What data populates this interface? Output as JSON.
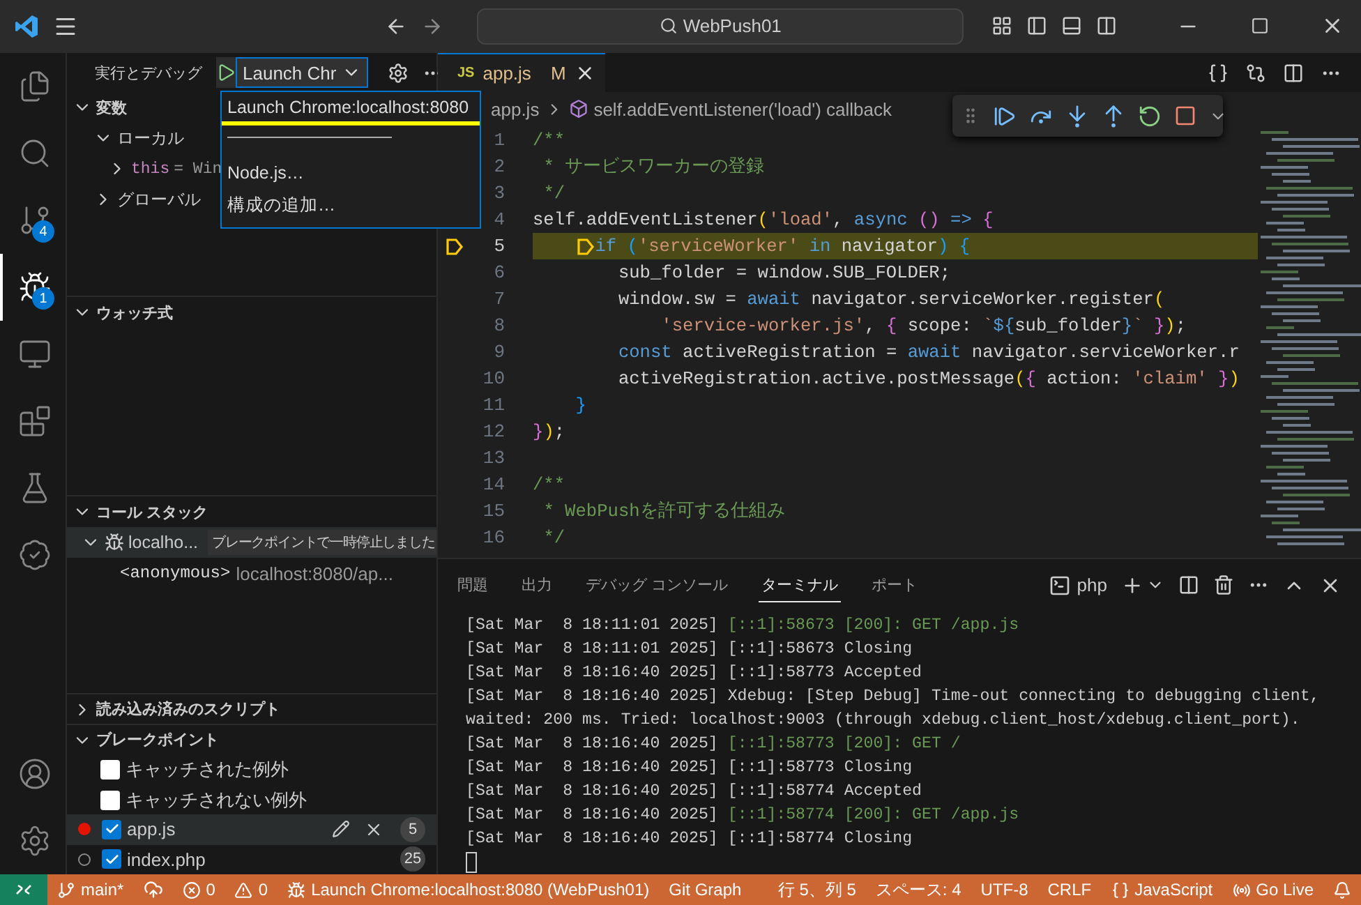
{
  "title_bar": {
    "search": "WebPush01"
  },
  "activity_bar": {
    "items": [
      {
        "kind": "explorer",
        "selected": false
      },
      {
        "kind": "search",
        "selected": false
      },
      {
        "kind": "source-control",
        "badge": "4",
        "selected": false
      },
      {
        "kind": "debug",
        "badge": "1",
        "selected": true
      },
      {
        "kind": "remote",
        "selected": false
      },
      {
        "kind": "extensions",
        "selected": false
      },
      {
        "kind": "testing",
        "selected": false
      },
      {
        "kind": "cloud",
        "selected": false
      }
    ],
    "bottom": [
      {
        "kind": "account"
      },
      {
        "kind": "settings"
      }
    ]
  },
  "sidebar": {
    "title": "実行とデバッグ",
    "config": "Launch Chr",
    "dropdown": [
      {
        "kind": "option",
        "label": "Launch Chrome:localhost:8080",
        "selected": true
      },
      {
        "kind": "separator"
      },
      {
        "kind": "option",
        "label": "Node.js…",
        "selected": false
      },
      {
        "kind": "option",
        "label": "構成の追加…",
        "selected": false
      }
    ],
    "variables": {
      "title": "変数",
      "expanded": true,
      "children": [
        {
          "name": "ローカル",
          "expanded": true,
          "children": [
            {
              "name": "this",
              "value": "= Win",
              "expanded": false
            }
          ]
        },
        {
          "name": "グローバル",
          "expanded": false
        }
      ]
    },
    "watch": {
      "title": "ウォッチ式",
      "expanded": true
    },
    "call_stack": {
      "title": "コール スタック",
      "expanded": true,
      "threads": [
        {
          "name": "localho...",
          "status": "ブレークポイントで一時停止しました",
          "expanded": true,
          "frames": [
            {
              "name": "<anonymous>",
              "location": "localhost:8080/ap..."
            }
          ]
        }
      ]
    },
    "loaded_scripts": {
      "title": "読み込み済みのスクリプト",
      "expanded": false
    },
    "breakpoints": {
      "title": "ブレークポイント",
      "expanded": true,
      "items": [
        {
          "kind": "exception",
          "label": "キャッチされた例外",
          "checked": false
        },
        {
          "kind": "exception",
          "label": "キャッチされない例外",
          "checked": false
        },
        {
          "kind": "file",
          "label": "app.js",
          "checked": true,
          "line": "5",
          "selected": true,
          "active": true
        },
        {
          "kind": "file",
          "label": "index.php",
          "checked": true,
          "line": "25",
          "selected": false,
          "active": false
        }
      ]
    }
  },
  "editor": {
    "tabs": [
      {
        "icon": "JS",
        "label": "app.js",
        "status": "M",
        "selected": true
      }
    ],
    "breadcrumb": [
      "app.js",
      "self.addEventListener('load') callback"
    ],
    "lines": [
      {
        "number": "1",
        "paused": false,
        "tokens": [
          {
            "kind": "comment",
            "text": "/**"
          }
        ]
      },
      {
        "number": "2",
        "paused": false,
        "tokens": [
          {
            "kind": "comment",
            "text": " * サービスワーカーの登録"
          }
        ]
      },
      {
        "number": "3",
        "paused": false,
        "tokens": [
          {
            "kind": "comment",
            "text": " */"
          }
        ]
      },
      {
        "number": "4",
        "paused": false,
        "tokens": [
          {
            "kind": "text",
            "text": "self.addEventListener"
          },
          {
            "kind": "bracket1",
            "text": "("
          },
          {
            "kind": "string",
            "text": "'load'"
          },
          {
            "kind": "text",
            "text": ", "
          },
          {
            "kind": "keyword",
            "text": "async "
          },
          {
            "kind": "bracket2",
            "text": "() "
          },
          {
            "kind": "keyword",
            "text": "=> "
          },
          {
            "kind": "bracket2",
            "text": "{"
          }
        ]
      },
      {
        "number": "5",
        "paused": true,
        "tokens": [
          {
            "kind": "keyword",
            "text": "    if "
          },
          {
            "kind": "bracket3",
            "text": "("
          },
          {
            "kind": "string",
            "text": "'serviceWorker' "
          },
          {
            "kind": "keyword",
            "text": "in"
          },
          {
            "kind": "text",
            "text": " navigator"
          },
          {
            "kind": "bracket3",
            "text": ") {"
          }
        ]
      },
      {
        "number": "6",
        "paused": false,
        "tokens": [
          {
            "kind": "text",
            "text": "        sub_folder = window.SUB_FOLDER;"
          }
        ]
      },
      {
        "number": "7",
        "paused": false,
        "tokens": [
          {
            "kind": "text",
            "text": "        window.sw = "
          },
          {
            "kind": "keyword",
            "text": "await"
          },
          {
            "kind": "text",
            "text": " navigator.serviceWorker.register"
          },
          {
            "kind": "bracket1",
            "text": "("
          }
        ]
      },
      {
        "number": "8",
        "paused": false,
        "tokens": [
          {
            "kind": "string",
            "text": "            'service-worker.js'"
          },
          {
            "kind": "text",
            "text": ", "
          },
          {
            "kind": "bracket2",
            "text": "{"
          },
          {
            "kind": "text",
            "text": " scope: "
          },
          {
            "kind": "string",
            "text": "`"
          },
          {
            "kind": "keyword",
            "text": "${"
          },
          {
            "kind": "text",
            "text": "sub_folder"
          },
          {
            "kind": "keyword",
            "text": "}"
          },
          {
            "kind": "string",
            "text": "` "
          },
          {
            "kind": "bracket2",
            "text": "}"
          },
          {
            "kind": "bracket1",
            "text": ")"
          },
          {
            "kind": "text",
            "text": ";"
          }
        ]
      },
      {
        "number": "9",
        "paused": false,
        "tokens": [
          {
            "kind": "keyword",
            "text": "        const"
          },
          {
            "kind": "text",
            "text": " activeRegistration = "
          },
          {
            "kind": "keyword",
            "text": "await"
          },
          {
            "kind": "text",
            "text": " navigator.serviceWorker.r"
          }
        ]
      },
      {
        "number": "10",
        "paused": false,
        "tokens": [
          {
            "kind": "text",
            "text": "        activeRegistration.active.postMessage"
          },
          {
            "kind": "bracket1",
            "text": "("
          },
          {
            "kind": "bracket2",
            "text": "{"
          },
          {
            "kind": "text",
            "text": " action: "
          },
          {
            "kind": "string",
            "text": "'claim' "
          },
          {
            "kind": "bracket2",
            "text": "}"
          },
          {
            "kind": "bracket1",
            "text": ")"
          }
        ]
      },
      {
        "number": "11",
        "paused": false,
        "tokens": [
          {
            "kind": "bracket3",
            "text": "    }"
          }
        ]
      },
      {
        "number": "12",
        "paused": false,
        "tokens": [
          {
            "kind": "bracket2",
            "text": "}"
          },
          {
            "kind": "bracket1",
            "text": ")"
          },
          {
            "kind": "text",
            "text": ";"
          }
        ]
      },
      {
        "number": "13",
        "paused": false
      },
      {
        "number": "14",
        "paused": false,
        "tokens": [
          {
            "kind": "comment",
            "text": "/**"
          }
        ]
      },
      {
        "number": "15",
        "paused": false,
        "tokens": [
          {
            "kind": "comment",
            "text": " * WebPushを許可する仕組み"
          }
        ]
      },
      {
        "number": "16",
        "paused": false,
        "tokens": [
          {
            "kind": "comment",
            "text": " */"
          }
        ]
      }
    ]
  },
  "panel": {
    "tabs": [
      {
        "label": "問題",
        "selected": false
      },
      {
        "label": "出力",
        "selected": false
      },
      {
        "label": "デバッグ コンソール",
        "selected": false
      },
      {
        "label": "ターミナル",
        "selected": true
      },
      {
        "label": "ポート",
        "selected": false
      }
    ],
    "terminal": "php",
    "lines": [
      [
        {
          "kind": "plain",
          "text": "[Sat Mar  8 18:11:01 2025] "
        },
        {
          "kind": "success",
          "text": "[::1]:58673 [200]: GET /app.js"
        }
      ],
      [
        {
          "kind": "plain",
          "text": "[Sat Mar  8 18:11:01 2025] [::1]:58673 Closing"
        }
      ],
      [
        {
          "kind": "plain",
          "text": "[Sat Mar  8 18:16:40 2025] [::1]:58773 Accepted"
        }
      ],
      [
        {
          "kind": "plain",
          "text": "[Sat Mar  8 18:16:40 2025] Xdebug: [Step Debug] Time-out connecting to debugging client,"
        }
      ],
      [
        {
          "kind": "plain",
          "text": "waited: 200 ms. Tried: localhost:9003 (through xdebug.client_host/xdebug.client_port)."
        }
      ],
      [
        {
          "kind": "plain",
          "text": "[Sat Mar  8 18:16:40 2025] "
        },
        {
          "kind": "success",
          "text": "[::1]:58773 [200]: GET /"
        }
      ],
      [
        {
          "kind": "plain",
          "text": "[Sat Mar  8 18:16:40 2025] [::1]:58773 Closing"
        }
      ],
      [
        {
          "kind": "plain",
          "text": "[Sat Mar  8 18:16:40 2025] [::1]:58774 Accepted"
        }
      ],
      [
        {
          "kind": "plain",
          "text": "[Sat Mar  8 18:16:40 2025] "
        },
        {
          "kind": "success",
          "text": "[::1]:58774 [200]: GET /app.js"
        }
      ],
      [
        {
          "kind": "plain",
          "text": "[Sat Mar  8 18:16:40 2025] [::1]:58774 Closing"
        }
      ]
    ]
  },
  "status_bar": {
    "left": [
      {
        "kind": "branch",
        "text": "main*"
      },
      {
        "kind": "sync"
      },
      {
        "kind": "errors",
        "text": "0"
      },
      {
        "kind": "warnings",
        "text": "0"
      },
      {
        "kind": "debug",
        "text": "Launch Chrome:localhost:8080 (WebPush01)"
      },
      {
        "kind": "plain",
        "text": "Git Graph"
      }
    ],
    "right": [
      {
        "kind": "plain",
        "text": "行 5、列 5"
      },
      {
        "kind": "plain",
        "text": "スペース: 4"
      },
      {
        "kind": "plain",
        "text": "UTF-8"
      },
      {
        "kind": "plain",
        "text": "CRLF"
      },
      {
        "kind": "language",
        "text": "JavaScript"
      },
      {
        "kind": "live",
        "text": "Go Live"
      },
      {
        "kind": "bell"
      }
    ]
  }
}
